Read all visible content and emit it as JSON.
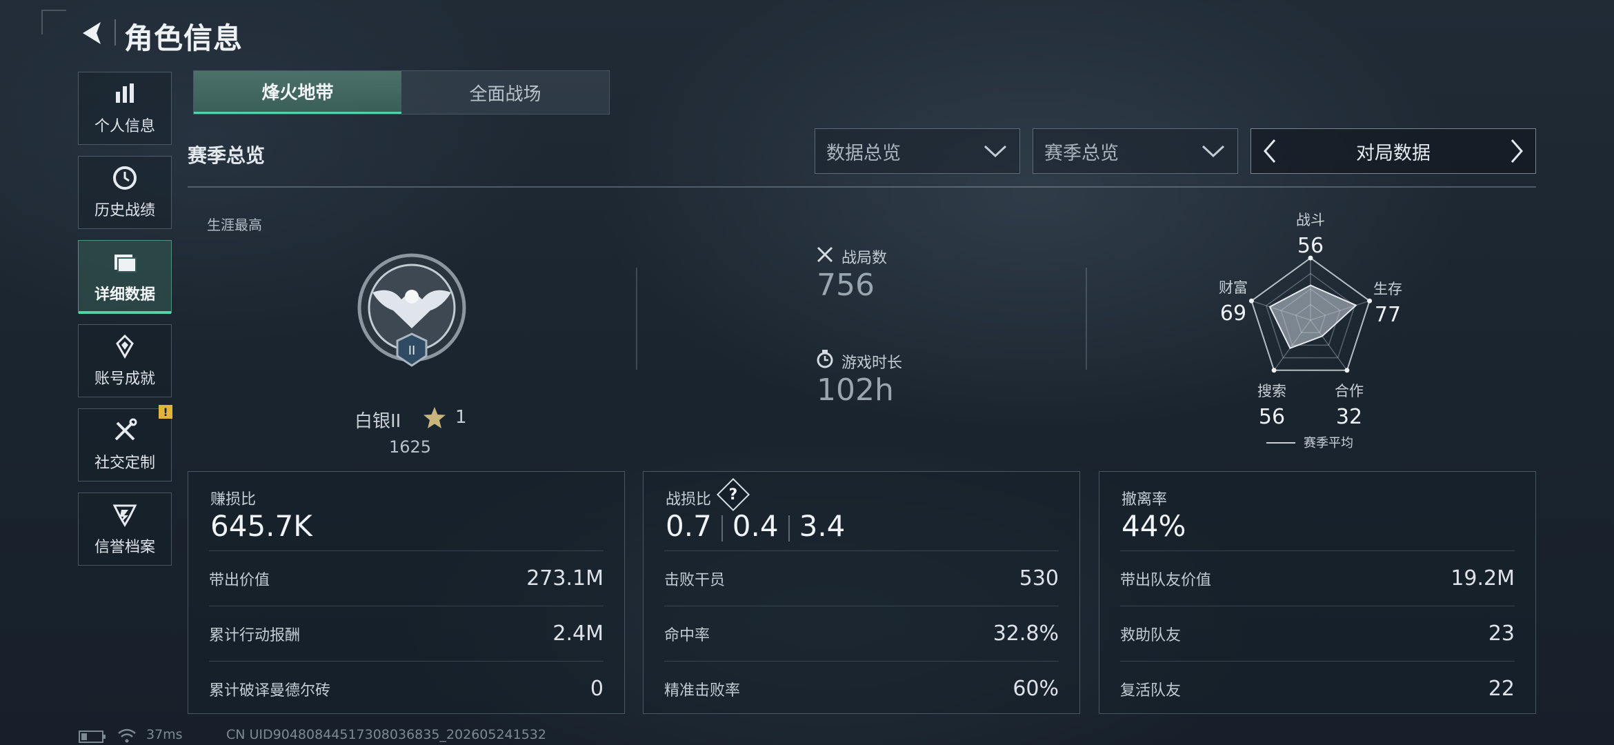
{
  "header": {
    "title": "角色信息"
  },
  "sidebar": {
    "items": [
      {
        "label": "个人信息",
        "icon": "bar-chart-icon"
      },
      {
        "label": "历史战绩",
        "icon": "clock-icon"
      },
      {
        "label": "详细数据",
        "icon": "folder-icon",
        "active": true
      },
      {
        "label": "账号成就",
        "icon": "achievement-icon"
      },
      {
        "label": "社交定制",
        "icon": "tools-icon",
        "badge": "!"
      },
      {
        "label": "信誉档案",
        "icon": "shield-icon"
      }
    ]
  },
  "tabs": [
    {
      "label": "烽火地带",
      "active": true
    },
    {
      "label": "全面战场",
      "active": false
    }
  ],
  "section": {
    "title": "赛季总览",
    "dropdown1": "数据总览",
    "dropdown2": "赛季总览",
    "pager_label": "对局数据"
  },
  "career": {
    "label": "生涯最高",
    "rank_name": "白银II",
    "stars": "1",
    "score": "1625",
    "badge_numeral": "II"
  },
  "stats": {
    "matches_label": "战局数",
    "matches_value": "756",
    "playtime_label": "游戏时长",
    "playtime_value": "102h"
  },
  "radar": {
    "axes": [
      {
        "label": "战斗",
        "value": 56
      },
      {
        "label": "生存",
        "value": 77
      },
      {
        "label": "合作",
        "value": 32
      },
      {
        "label": "搜索",
        "value": 56
      },
      {
        "label": "财富",
        "value": 69
      }
    ],
    "legend": "赛季平均"
  },
  "cards": {
    "profit": {
      "title": "赚损比",
      "big": "645.7K",
      "rows": [
        {
          "label": "带出价值",
          "value": "273.1M"
        },
        {
          "label": "累计行动报酬",
          "value": "2.4M"
        },
        {
          "label": "累计破译曼德尔砖",
          "value": "0"
        }
      ]
    },
    "combat": {
      "title": "战损比",
      "kd": [
        "0.7",
        "0.4",
        "3.4"
      ],
      "help": "?",
      "rows": [
        {
          "label": "击败干员",
          "value": "530"
        },
        {
          "label": "命中率",
          "value": "32.8%"
        },
        {
          "label": "精准击败率",
          "value": "60%"
        }
      ]
    },
    "extract": {
      "title": "撤离率",
      "big": "44%",
      "rows": [
        {
          "label": "带出队友价值",
          "value": "19.2M"
        },
        {
          "label": "救助队友",
          "value": "23"
        },
        {
          "label": "复活队友",
          "value": "22"
        }
      ]
    }
  },
  "footer": {
    "ping": "37ms",
    "uid": "CN UID9048084451730803683​5_202605241532"
  }
}
